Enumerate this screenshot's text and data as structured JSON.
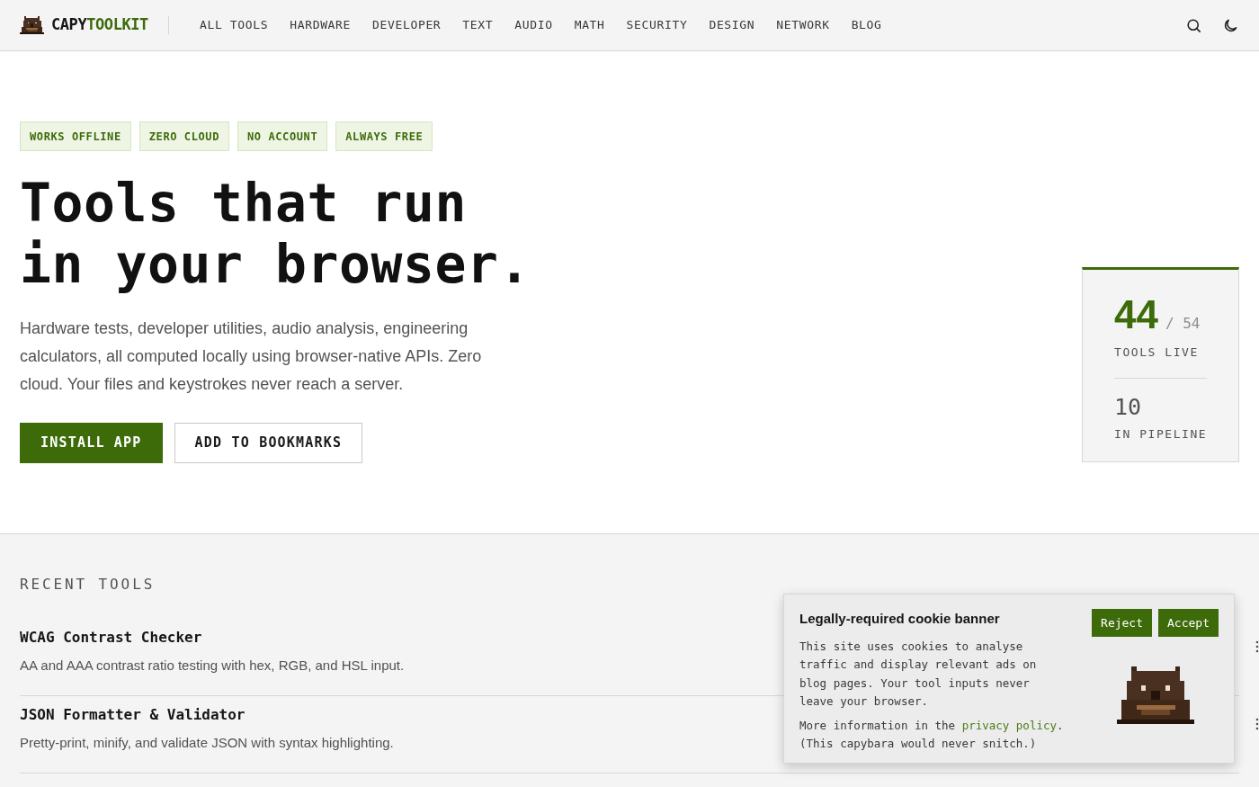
{
  "brand": {
    "part_1": "CAPY",
    "part_2": "TOOLKIT"
  },
  "nav": [
    {
      "label": "ALL TOOLS"
    },
    {
      "label": "HARDWARE"
    },
    {
      "label": "DEVELOPER"
    },
    {
      "label": "TEXT"
    },
    {
      "label": "AUDIO"
    },
    {
      "label": "MATH"
    },
    {
      "label": "SECURITY"
    },
    {
      "label": "DESIGN"
    },
    {
      "label": "NETWORK"
    },
    {
      "label": "BLOG"
    }
  ],
  "hero": {
    "badges": [
      "WORKS OFFLINE",
      "ZERO CLOUD",
      "NO ACCOUNT",
      "ALWAYS FREE"
    ],
    "title_lines": [
      "Tools that run",
      "in your browser."
    ],
    "description": "Hardware tests, developer utilities, audio analysis, engineering calculators, all computed locally using browser-native APIs. Zero cloud. Your files and keystrokes never reach a server.",
    "buttons": [
      {
        "label": "INSTALL APP",
        "kind": "primary"
      },
      {
        "label": "ADD TO BOOKMARKS",
        "kind": "secondary"
      }
    ]
  },
  "stats": {
    "live": "44",
    "total": "/ 54",
    "live_label": "TOOLS LIVE",
    "pipeline": "10",
    "pipeline_label": "IN PIPELINE"
  },
  "recent": {
    "heading": "RECENT TOOLS",
    "tools": [
      {
        "title": "WCAG Contrast Checker",
        "description": "AA and AAA contrast ratio testing with hex, RGB, and HSL input."
      },
      {
        "title": "JSON Formatter & Validator",
        "description": "Pretty-print, minify, and validate JSON with syntax highlighting."
      }
    ]
  },
  "cookie_banner": {
    "title": "Legally-required cookie banner",
    "body": "This site uses cookies to analyse traffic and display relevant ads on blog pages. Your tool inputs never leave your browser.",
    "more_before": "More information in the",
    "link": "privacy policy",
    "more_after": ".",
    "note": "(This capybara would never snitch.)",
    "buttons": [
      "Reject",
      "Accept"
    ]
  }
}
